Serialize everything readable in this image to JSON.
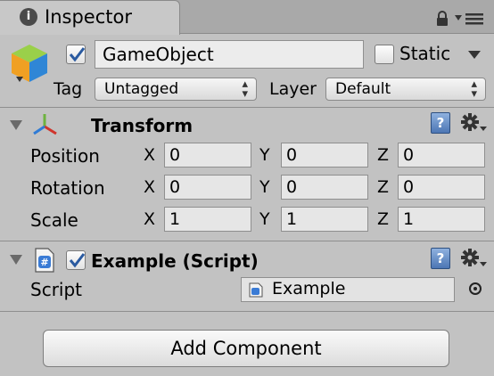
{
  "tab": {
    "label": "Inspector",
    "info_glyph": "i"
  },
  "header": {
    "active": true,
    "object_name": "GameObject",
    "static_checked": false,
    "static_label": "Static",
    "tag_label": "Tag",
    "tag_value": "Untagged",
    "layer_label": "Layer",
    "layer_value": "Default"
  },
  "transform": {
    "title": "Transform",
    "axes": {
      "x": "X",
      "y": "Y",
      "z": "Z"
    },
    "position": {
      "label": "Position",
      "x": "0",
      "y": "0",
      "z": "0"
    },
    "rotation": {
      "label": "Rotation",
      "x": "0",
      "y": "0",
      "z": "0"
    },
    "scale": {
      "label": "Scale",
      "x": "1",
      "y": "1",
      "z": "1"
    }
  },
  "script_component": {
    "title": "Example (Script)",
    "enabled": true,
    "script_label": "Script",
    "script_value": "Example"
  },
  "help_glyph": "?",
  "add_component_label": "Add Component",
  "icons": [
    "info-icon",
    "lock-icon",
    "menu-icon",
    "gameobject-cube-icon",
    "checkmark-icon",
    "foldout-arrow-icon",
    "transform-axes-icon",
    "help-book-icon",
    "gear-icon",
    "script-icon",
    "object-picker-icon",
    "dropdown-arrow-icon"
  ],
  "colors": {
    "panel": "#c2c2c2",
    "tabbar": "#a9a9a9",
    "help": "#4c76b4",
    "check": "#2a5aa0"
  }
}
